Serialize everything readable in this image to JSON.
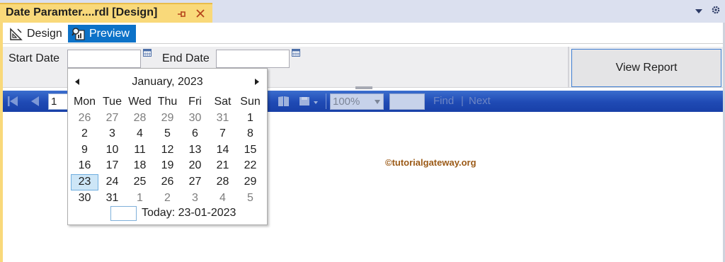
{
  "window": {
    "tab_title": "Date Paramter....rdl [Design]"
  },
  "mode_bar": {
    "design_label": "Design",
    "preview_label": "Preview",
    "active_mode": "Preview"
  },
  "parameters": {
    "start_date_label": "Start Date",
    "start_date_value": "",
    "end_date_label": "End Date",
    "end_date_value": "",
    "view_report_label": "View Report"
  },
  "toolbar": {
    "page_number": "1",
    "zoom": "100%",
    "find_value": "",
    "find_label": "Find",
    "separator": "|",
    "next_label": "Next"
  },
  "watermark": "©tutorialgateway.org",
  "calendar": {
    "title": "January, 2023",
    "weekdays": [
      "Mon",
      "Tue",
      "Wed",
      "Thu",
      "Fri",
      "Sat",
      "Sun"
    ],
    "weeks": [
      [
        {
          "d": "26",
          "o": true
        },
        {
          "d": "27",
          "o": true
        },
        {
          "d": "28",
          "o": true
        },
        {
          "d": "29",
          "o": true
        },
        {
          "d": "30",
          "o": true
        },
        {
          "d": "31",
          "o": true
        },
        {
          "d": "1"
        }
      ],
      [
        {
          "d": "2"
        },
        {
          "d": "3"
        },
        {
          "d": "4"
        },
        {
          "d": "5"
        },
        {
          "d": "6"
        },
        {
          "d": "7"
        },
        {
          "d": "8"
        }
      ],
      [
        {
          "d": "9"
        },
        {
          "d": "10"
        },
        {
          "d": "11"
        },
        {
          "d": "12"
        },
        {
          "d": "13"
        },
        {
          "d": "14"
        },
        {
          "d": "15"
        }
      ],
      [
        {
          "d": "16"
        },
        {
          "d": "17"
        },
        {
          "d": "18"
        },
        {
          "d": "19"
        },
        {
          "d": "20"
        },
        {
          "d": "21"
        },
        {
          "d": "22"
        }
      ],
      [
        {
          "d": "23",
          "s": true
        },
        {
          "d": "24"
        },
        {
          "d": "25"
        },
        {
          "d": "26"
        },
        {
          "d": "27"
        },
        {
          "d": "28"
        },
        {
          "d": "29"
        }
      ],
      [
        {
          "d": "30"
        },
        {
          "d": "31"
        },
        {
          "d": "1",
          "o": true
        },
        {
          "d": "2",
          "o": true
        },
        {
          "d": "3",
          "o": true
        },
        {
          "d": "4",
          "o": true
        },
        {
          "d": "5",
          "o": true
        }
      ]
    ],
    "selected_day": "23",
    "today_label": "Today: 23-01-2023"
  },
  "colors": {
    "tab_accent": "#f9d97a",
    "preview_accent": "#0c72c8",
    "toolbar_blue": "#1f4ab4",
    "selection": "#cde6f7"
  },
  "icons": {
    "pin": "pin-icon",
    "close": "close-icon",
    "design": "ruler-triangle-icon",
    "preview": "magnifier-report-icon",
    "calendar": "calendar-icon",
    "first_page": "first-page-icon",
    "previous_page": "previous-page-icon"
  }
}
